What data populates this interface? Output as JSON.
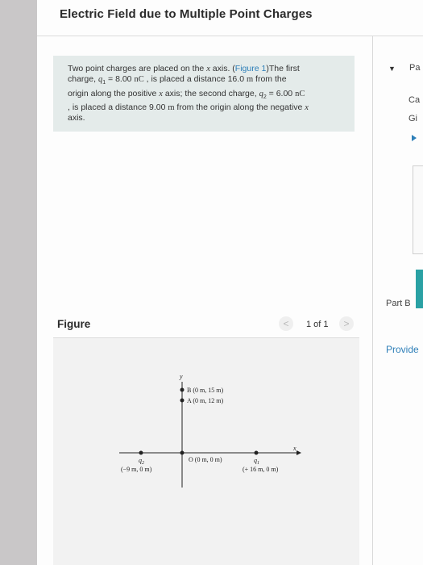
{
  "header": {
    "title": "Electric Field due to Multiple Point Charges"
  },
  "problem": {
    "line1_a": "Two point charges are placed on the ",
    "line1_x": "x",
    "line1_b": " axis. (",
    "figure_link": "Figure 1",
    "line1_c": ")The first",
    "line2_a": "charge, ",
    "q1_sym": "q",
    "q1_sub": "1",
    "q1_val": " = 8.00 ",
    "q1_unit": "nC",
    "line2_b": " , is placed a distance 16.0 ",
    "m1": "m",
    "line2_c": " from the",
    "line3_a": "origin along the positive ",
    "line3_x": "x",
    "line3_b": " axis; the second charge, ",
    "q2_sym": "q",
    "q2_sub": "2",
    "q2_val": " = 6.00 ",
    "q2_unit": "nC",
    "line4_a": ", is placed a distance 9.00 ",
    "m2": "m",
    "line4_b": " from the origin along the negative ",
    "line4_x": "x",
    "line5": "axis."
  },
  "right_panel": {
    "part_a_fragment": "Pa",
    "calc_fragment": "Ca",
    "give_fragment": "Gi",
    "part_b_label": "Part B",
    "provide_label": "Provide"
  },
  "figure": {
    "label": "Figure",
    "prev": "<",
    "counter": "1 of 1",
    "next": ">",
    "axis_y": "y",
    "axis_x": "x",
    "point_b": "B (0 m, 15 m)",
    "point_a": "A (0 m, 12 m)",
    "point_o": "O (0 m, 0 m)",
    "q1_sym": "q",
    "q1_sub": "1",
    "q1_coord": "(+ 16 m, 0 m)",
    "q2_sym": "q",
    "q2_sub": "2",
    "q2_coord": "(−9 m, 0 m)"
  },
  "colors": {
    "link": "#2e7fb8",
    "problem_bg": "#e4ebea",
    "accent_teal": "#2aa1a4"
  }
}
